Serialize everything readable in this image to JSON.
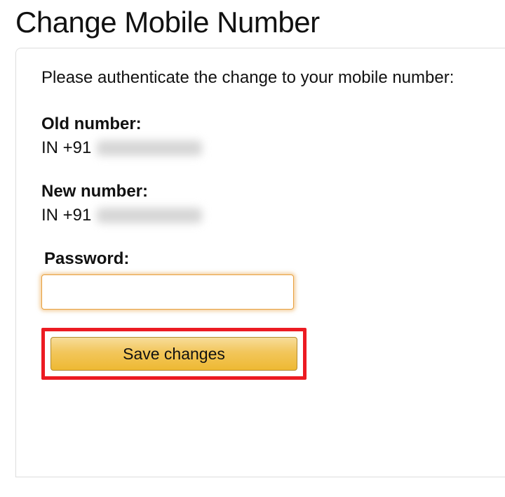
{
  "heading": "Change Mobile Number",
  "instruction": "Please authenticate the change to your mobile number:",
  "old": {
    "label": "Old number:",
    "prefix": "IN +91"
  },
  "new": {
    "label": "New number:",
    "prefix": "IN +91"
  },
  "password": {
    "label": "Password:",
    "value": ""
  },
  "actions": {
    "save_label": "Save changes"
  },
  "colors": {
    "accent": "#e89f3c",
    "highlight_border": "#ec1b22",
    "button_from": "#f7dd9a",
    "button_to": "#eeb933"
  }
}
